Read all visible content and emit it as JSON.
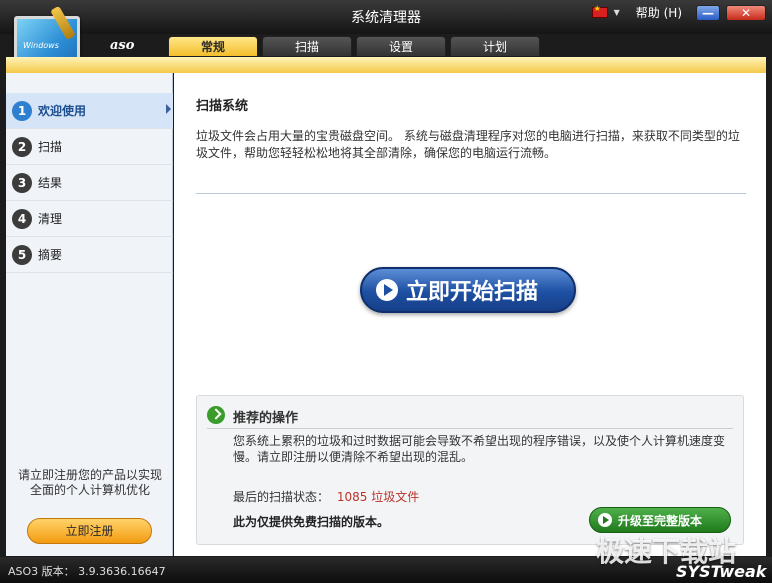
{
  "window": {
    "title": "系统清理器",
    "help": "帮助",
    "help_key": "(H)",
    "minimize": "—",
    "close": "✕"
  },
  "brand": "aso",
  "logo_screen_text": "Windows",
  "tabs": [
    {
      "label": "常规",
      "active": true
    },
    {
      "label": "扫描",
      "active": false
    },
    {
      "label": "设置",
      "active": false
    },
    {
      "label": "计划",
      "active": false
    }
  ],
  "sidebar": {
    "steps": [
      {
        "num": "1",
        "label": "欢迎使用",
        "active": true
      },
      {
        "num": "2",
        "label": "扫描",
        "active": false
      },
      {
        "num": "3",
        "label": "结果",
        "active": false
      },
      {
        "num": "4",
        "label": "清理",
        "active": false
      },
      {
        "num": "5",
        "label": "摘要",
        "active": false
      }
    ],
    "register_text": "请立即注册您的产品以实现全面的个人计算机优化",
    "register_button": "立即注册"
  },
  "main": {
    "title": "扫描系统",
    "description": "垃圾文件会占用大量的宝贵磁盘空间。 系统与磁盘清理程序对您的电脑进行扫描，来获取不同类型的垃圾文件，帮助您轻轻松松地将其全部清除，确保您的电脑运行流畅。",
    "scan_button": "立即开始扫描"
  },
  "recommend": {
    "title": "推荐的操作",
    "description": "您系统上累积的垃圾和过时数据可能会导致不希望出现的程序错误，以及使个人计算机速度变慢。请立即注册以便清除不希望出现的混乱。",
    "status_label": "最后的扫描状态：",
    "status_value": "1085 垃圾文件",
    "free_note": "此为仅提供免费扫描的版本。",
    "upgrade_button": "升级至完整版本"
  },
  "statusbar": {
    "version": "ASO3 版本： 3.9.3636.16647",
    "vendor": "SYSTweak"
  },
  "watermark": "极速下载站",
  "colors": {
    "accent": "#f3bf2a",
    "scan_button": "#1d4fa3",
    "upgrade_button": "#1f7a1b",
    "status_value": "#b8342a"
  }
}
